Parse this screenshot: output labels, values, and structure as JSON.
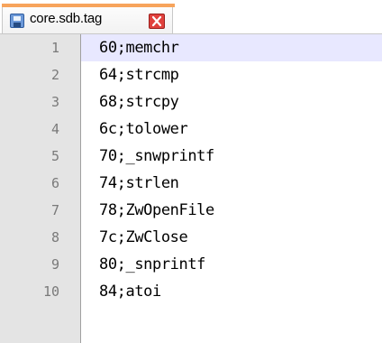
{
  "tab": {
    "title": "core.sdb.tag"
  },
  "icons": {
    "file_icon": "save-icon",
    "close_icon": "close-icon"
  },
  "colors": {
    "tab_accent": "#f7a45c",
    "current_line": "#e8e8ff",
    "gutter": "#e4e4e4",
    "close_button": "#e0413d"
  },
  "editor": {
    "current_line": 1,
    "lines": [
      {
        "number": "1",
        "text": "60;memchr"
      },
      {
        "number": "2",
        "text": "64;strcmp"
      },
      {
        "number": "3",
        "text": "68;strcpy"
      },
      {
        "number": "4",
        "text": "6c;tolower"
      },
      {
        "number": "5",
        "text": "70;_snwprintf"
      },
      {
        "number": "6",
        "text": "74;strlen"
      },
      {
        "number": "7",
        "text": "78;ZwOpenFile"
      },
      {
        "number": "8",
        "text": "7c;ZwClose"
      },
      {
        "number": "9",
        "text": "80;_snprintf"
      },
      {
        "number": "10",
        "text": "84;atoi"
      }
    ]
  }
}
